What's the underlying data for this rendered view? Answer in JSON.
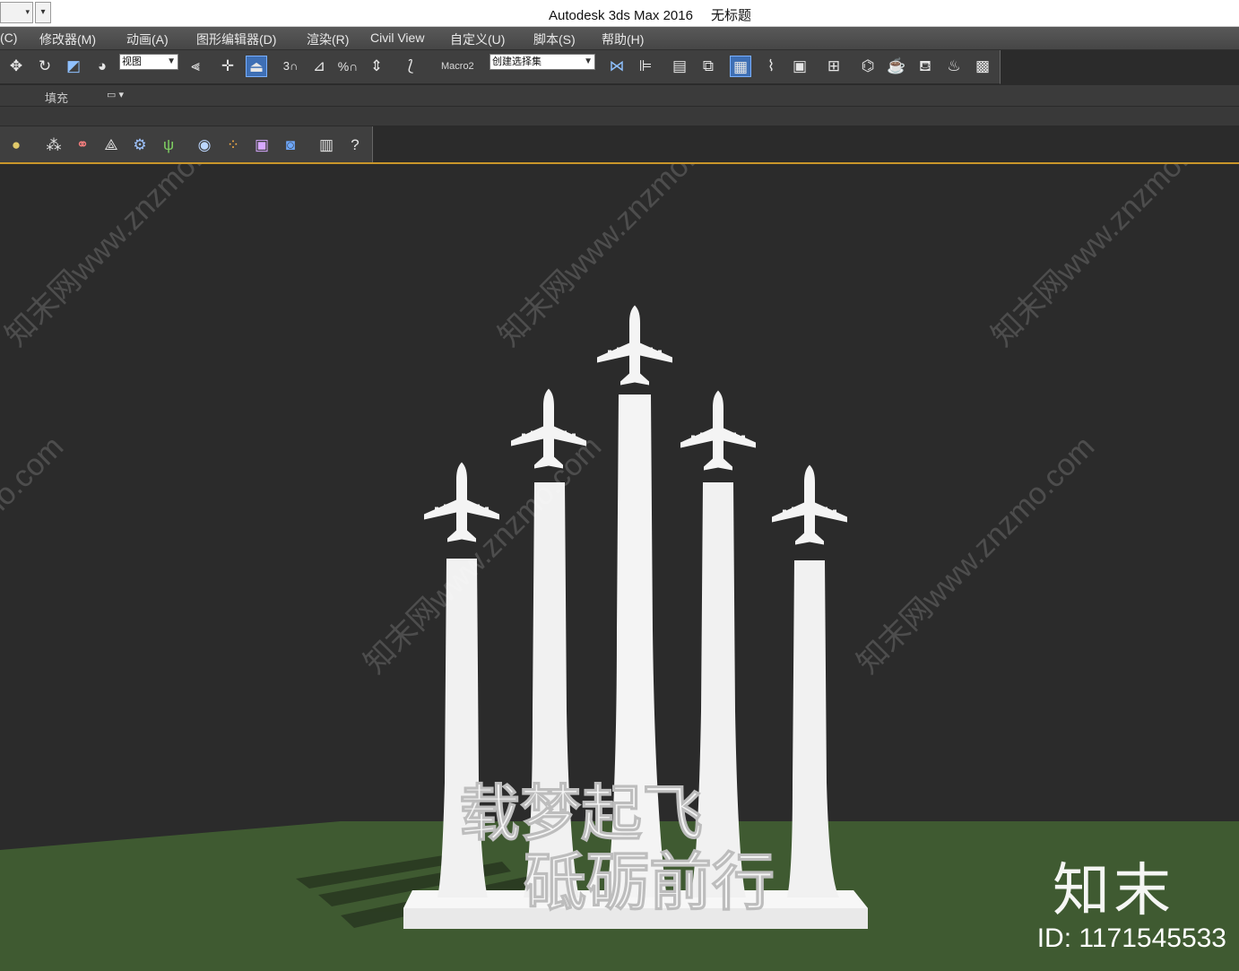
{
  "window": {
    "app_title": "Autodesk 3ds Max 2016",
    "file_title": "无标题"
  },
  "menu": [
    "(C)",
    "修改器(M)",
    "动画(A)",
    "图形编辑器(D)",
    "渲染(R)",
    "Civil View",
    "自定义(U)",
    "脚本(S)",
    "帮助(H)"
  ],
  "toolbar": {
    "view_select": "视图",
    "snap_label": "3",
    "macro_label": "Macro2",
    "selection_set": "创建选择集"
  },
  "ribbon": {
    "tab_label": "填充"
  },
  "scene": {
    "slogan_line1": "载梦起飞",
    "slogan_line2": "砥砺前行"
  },
  "watermark": {
    "text": "知末网www.znzmo.com",
    "brand": "知末",
    "id": "ID: 1171545533"
  },
  "colors": {
    "ui_dark": "#3f3f3f",
    "viewport_bg": "#2b2b2b",
    "ground": "#3f5a31",
    "sculpture": "#f2f2f2",
    "accent_orange": "#c9962a",
    "active_blue": "#3e6fb5"
  }
}
